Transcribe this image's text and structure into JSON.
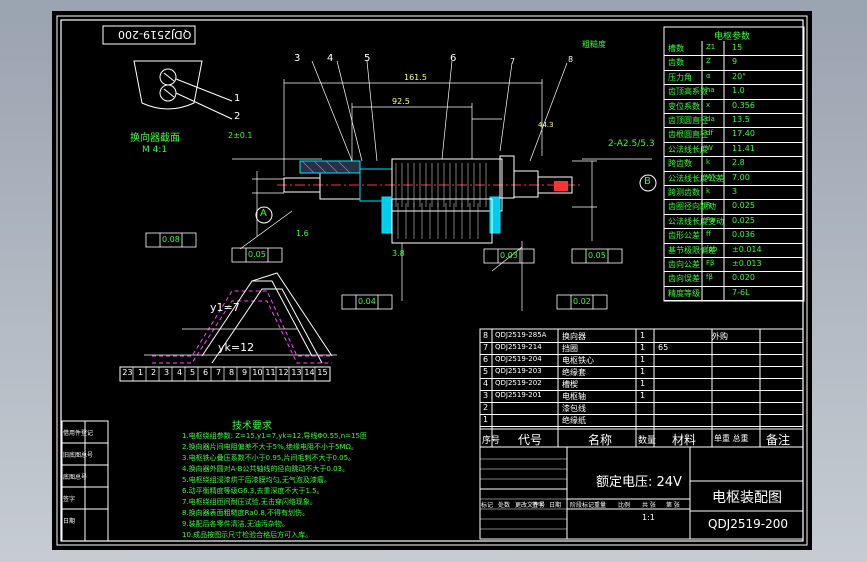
{
  "drawing_number_box": "QDJ2519-200",
  "section_label": "换向器截面",
  "section_scale": "M 4:1",
  "balloons": [
    "1",
    "2",
    "3",
    "4",
    "5",
    "6",
    "7",
    "8"
  ],
  "datum_labels": [
    "A",
    "B"
  ],
  "dims": {
    "d1": "161.5",
    "d2": "92.5",
    "d3": "44.3",
    "thread": "2-A2.5/5.3",
    "tol1": "2±0.1",
    "tol2": "3.8",
    "tol3": "1.6"
  },
  "fcf": [
    "0.08",
    "0.05",
    "0.05",
    "0.04",
    "0.03",
    "0.02"
  ],
  "surface": "粗糙度",
  "winding": {
    "y1": "y1=7",
    "yk": "yk=12",
    "slots": [
      "23",
      "1",
      "2",
      "3",
      "4",
      "5",
      "6",
      "7",
      "8",
      "9",
      "10",
      "11",
      "12",
      "13",
      "14",
      "15"
    ]
  },
  "params_title": "电枢参数",
  "params": [
    {
      "label": "槽数",
      "sym": "Z1",
      "val": "15"
    },
    {
      "label": "齿数",
      "sym": "Z",
      "val": "9"
    },
    {
      "label": "压力角",
      "sym": "α",
      "val": "20°"
    },
    {
      "label": "齿顶高系数",
      "sym": "ha",
      "val": "1.0"
    },
    {
      "label": "变位系数",
      "sym": "x",
      "val": "0.356"
    },
    {
      "label": "齿顶圆直径",
      "sym": "da",
      "val": "13.5"
    },
    {
      "label": "齿根圆直径",
      "sym": "df",
      "val": "17.40"
    },
    {
      "label": "公法线长度",
      "sym": "W",
      "val": "11.41"
    },
    {
      "label": "跨齿数",
      "sym": "k",
      "val": "2.8"
    },
    {
      "label": "公法线长度公差",
      "sym": "Wk",
      "val": "7.00"
    },
    {
      "label": "跨测齿数",
      "sym": "k",
      "val": "3"
    },
    {
      "label": "齿圈径向跳动",
      "sym": "Fr",
      "val": "0.025"
    },
    {
      "label": "公法线长度变动",
      "sym": "Fw",
      "val": "0.025"
    },
    {
      "label": "齿形公差",
      "sym": "ff",
      "val": "0.036"
    },
    {
      "label": "基节极限偏差",
      "sym": "fpb",
      "val": "±0.014"
    },
    {
      "label": "齿向公差",
      "sym": "Fβ",
      "val": "±0.013"
    },
    {
      "label": "齿向误差",
      "sym": "fβ",
      "val": "0.020"
    },
    {
      "label": "精度等级",
      "sym": "",
      "val": "7-6L"
    }
  ],
  "tech_title": "技术要求",
  "tech_reqs": [
    "1.电枢绕组参数: Z=15,y1=7,yk=12,导线Φ0.55,n=15匝",
    "2.换向器片间电阻偏差不大于5%,绝缘电阻不小于5MΩ。",
    "3.电枢铁心叠压系数不小于0.95,片间毛刺不大于0.05。",
    "4.换向器外圆对A-B公共轴线的径向跳动不大于0.03。",
    "5.电枢绕组浸漆烘干后漆膜均匀,无气泡及漆瘤。",
    "6.动平衡精度等级G6.3,去重深度不大于1.5。",
    "7.电枢绕组匝间耐压试验,无击穿闪络现象。",
    "8.换向器表面粗糙度Ra0.8,不得有划伤。",
    "9.装配后各零件清洁,无油污杂物。",
    "10.成品按图示尺寸检验合格后方可入库。"
  ],
  "bom": [
    {
      "no": "8",
      "code": "QDJ2519-285A",
      "name": "换向器",
      "qty": "1",
      "mat": "",
      "note": "外购"
    },
    {
      "no": "7",
      "code": "QDJ2519-214",
      "name": "挡圈",
      "qty": "1",
      "mat": "65",
      "note": ""
    },
    {
      "no": "6",
      "code": "QDJ2519-204",
      "name": "电枢铁心",
      "qty": "1",
      "mat": "",
      "note": ""
    },
    {
      "no": "5",
      "code": "QDJ2519-203",
      "name": "绝缘套",
      "qty": "1",
      "mat": "",
      "note": ""
    },
    {
      "no": "4",
      "code": "QDJ2519-202",
      "name": "槽楔",
      "qty": "1",
      "mat": "",
      "note": ""
    },
    {
      "no": "3",
      "code": "QDJ2519-201",
      "name": "电枢轴",
      "qty": "1",
      "mat": "",
      "note": ""
    },
    {
      "no": "2",
      "code": "",
      "name": "漆包线",
      "qty": "",
      "mat": "",
      "note": ""
    },
    {
      "no": "1",
      "code": "",
      "name": "绝缘纸",
      "qty": "",
      "mat": "",
      "note": ""
    }
  ],
  "bom_headers": {
    "no": "序号",
    "code": "代号",
    "name": "名称",
    "qty": "数量",
    "mat": "材料",
    "wt": "单重 总重",
    "note": "备注"
  },
  "title_block": {
    "voltage": "额定电压: 24V",
    "drawing_name": "电枢装配图",
    "drawing_number": "QDJ2519-200",
    "scale": "1:1",
    "row_labels": [
      "标记",
      "处数",
      "更改文件号",
      "签字",
      "日期"
    ],
    "small_labels": [
      "阶段标记",
      "重量",
      "比例",
      "共 张",
      "第 张"
    ]
  },
  "left_strip": [
    "借用件登记",
    "旧底图总号",
    "底图总号",
    "签字",
    "日期"
  ]
}
